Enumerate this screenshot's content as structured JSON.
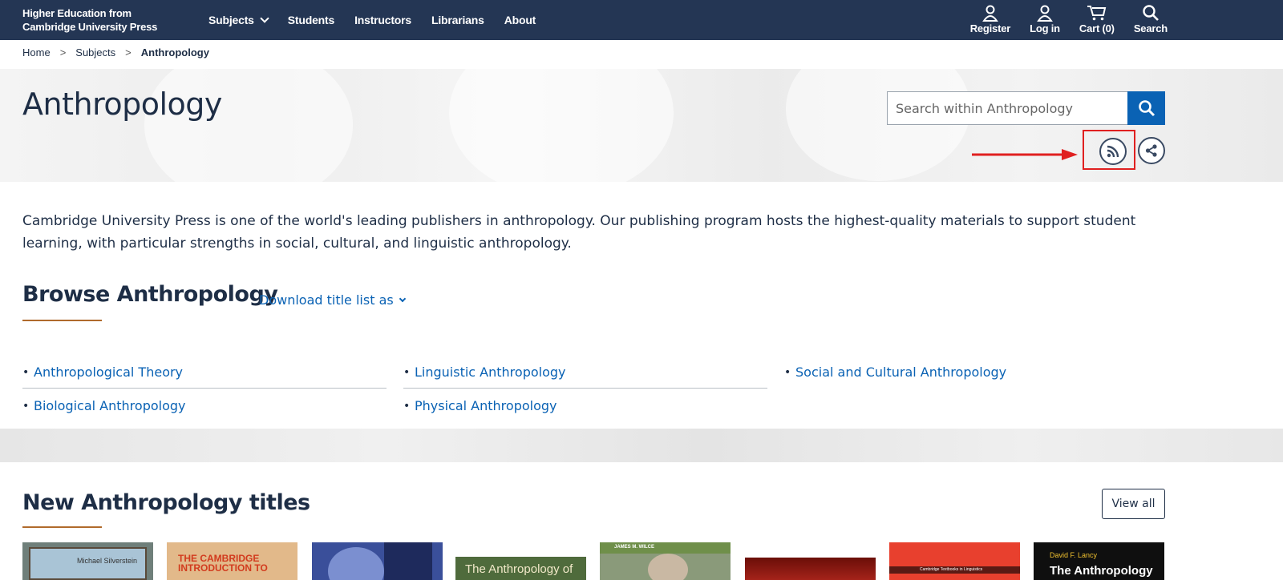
{
  "header": {
    "brand": "Higher Education from Cambridge University Press",
    "nav": [
      "Subjects",
      "Students",
      "Instructors",
      "Librarians",
      "About"
    ],
    "utility": [
      {
        "label": "Register",
        "icon": "person-icon"
      },
      {
        "label": "Log in",
        "icon": "person-icon"
      },
      {
        "label": "Cart (0)",
        "icon": "cart-icon"
      },
      {
        "label": "Search",
        "icon": "search-icon"
      }
    ]
  },
  "breadcrumb": {
    "items": [
      "Home",
      "Subjects",
      "Anthropology"
    ],
    "separator": ">"
  },
  "hero": {
    "title": "Anthropology",
    "search_placeholder": "Search within Anthropology",
    "rss_icon": "rss-icon",
    "share_icon": "share-icon"
  },
  "description": "Cambridge University Press is one of the world's leading publishers in anthropology. Our publishing program hosts the highest-quality materials to support student learning, with particular strengths in social, cultural, and linguistic anthropology.",
  "browse": {
    "title": "Browse Anthropology",
    "download_label": "Download title list as",
    "subjects": [
      "Anthropological Theory",
      "Linguistic Anthropology",
      "Social and Cultural Anthropology",
      "Biological Anthropology",
      "Physical Anthropology"
    ]
  },
  "new_titles": {
    "title": "New Anthropology titles",
    "view_all": "View all",
    "books": [
      {
        "cover_text": "Michael Silverstein",
        "color": "#7a8a86"
      },
      {
        "cover_text": "THE CAMBRIDGE INTRODUCTION TO",
        "color": "#e2b98a"
      },
      {
        "cover_text": "",
        "color": "#3a4f9a"
      },
      {
        "cover_text": "The Anthropology of",
        "color": "#4f6b3c"
      },
      {
        "cover_text": "JAMES M. WILCE",
        "color": "#8a9a7a"
      },
      {
        "cover_text": "",
        "color": "#8c1a12"
      },
      {
        "cover_text": "Cambridge Textbooks in Linguistics",
        "color": "#e8402e"
      },
      {
        "cover_text": "David F. Lancy",
        "cover_title": "The Anthropology",
        "color": "#0f0f0f"
      }
    ]
  },
  "colors": {
    "nav_bg": "#243654",
    "link": "#0a62b4",
    "accent_underline": "#b06a2c",
    "annotation": "#e02020"
  }
}
